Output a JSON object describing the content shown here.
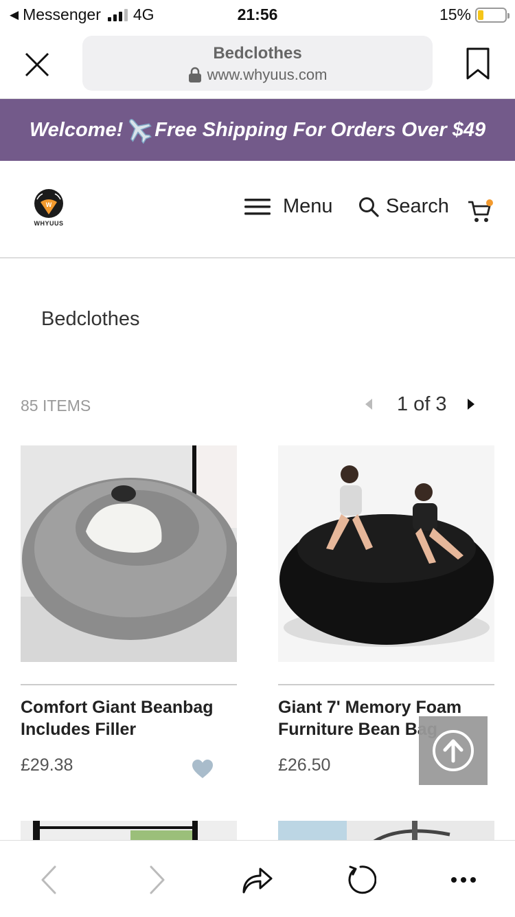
{
  "status_bar": {
    "back_app": "Messenger",
    "network": "4G",
    "time": "21:56",
    "battery": "15%"
  },
  "browser": {
    "page_title": "Bedclothes",
    "domain": "www.whyuus.com"
  },
  "promo": {
    "text_before": "Welcome!",
    "text_after": "Free Shipping For Orders Over $49"
  },
  "header": {
    "logo_text": "WHYUUS",
    "menu_label": "Menu",
    "search_label": "Search"
  },
  "collection": {
    "title": "Bedclothes",
    "items_count": "85 ITEMS",
    "pager": "1 of 3"
  },
  "products": [
    {
      "name_line1": "Comfort Giant Beanbag",
      "name_line2": "Includes Filler",
      "price": "£29.38"
    },
    {
      "name_line1": "Giant 7' Memory Foam",
      "name_line2": "Furniture Bean Bag",
      "price": "£26.50"
    }
  ],
  "colors": {
    "promo_bg": "#735a8a",
    "accent_orange": "#f39a2e",
    "heart": "#a9bccb"
  }
}
